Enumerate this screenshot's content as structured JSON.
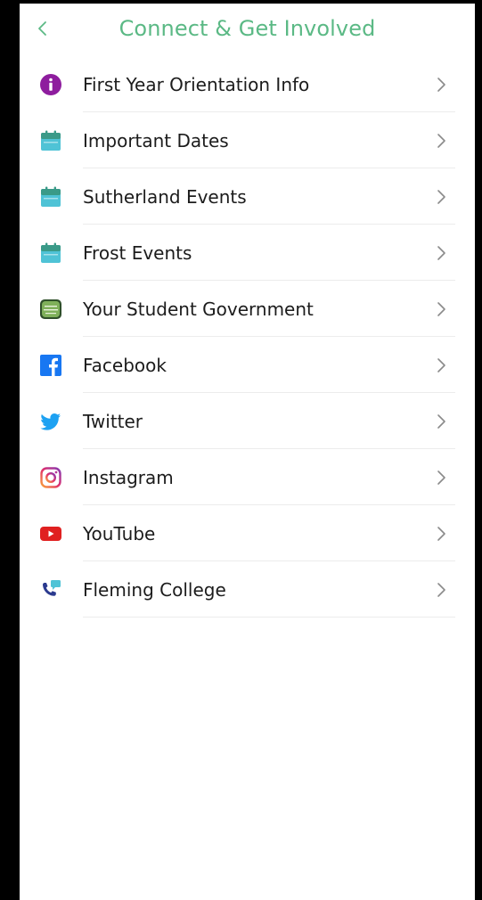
{
  "header": {
    "title": "Connect & Get Involved"
  },
  "items": [
    {
      "label": "First Year Orientation Info",
      "icon": "info-icon"
    },
    {
      "label": "Important Dates",
      "icon": "calendar-icon"
    },
    {
      "label": "Sutherland Events",
      "icon": "calendar-icon"
    },
    {
      "label": "Frost Events",
      "icon": "calendar-icon"
    },
    {
      "label": "Your Student Government",
      "icon": "student-council-logo-icon"
    },
    {
      "label": "Facebook",
      "icon": "facebook-icon"
    },
    {
      "label": "Twitter",
      "icon": "twitter-icon"
    },
    {
      "label": "Instagram",
      "icon": "instagram-icon"
    },
    {
      "label": "YouTube",
      "icon": "youtube-icon"
    },
    {
      "label": "Fleming College",
      "icon": "phone-chat-icon"
    }
  ],
  "colors": {
    "accent": "#5bb985",
    "info": "#8e1d9e",
    "calendar": "#4fc3d6",
    "calendar_top": "#3a9a88",
    "facebook": "#1877f2",
    "twitter": "#1da1f2",
    "youtube": "#e02020",
    "chevron": "#8a8a8a"
  }
}
